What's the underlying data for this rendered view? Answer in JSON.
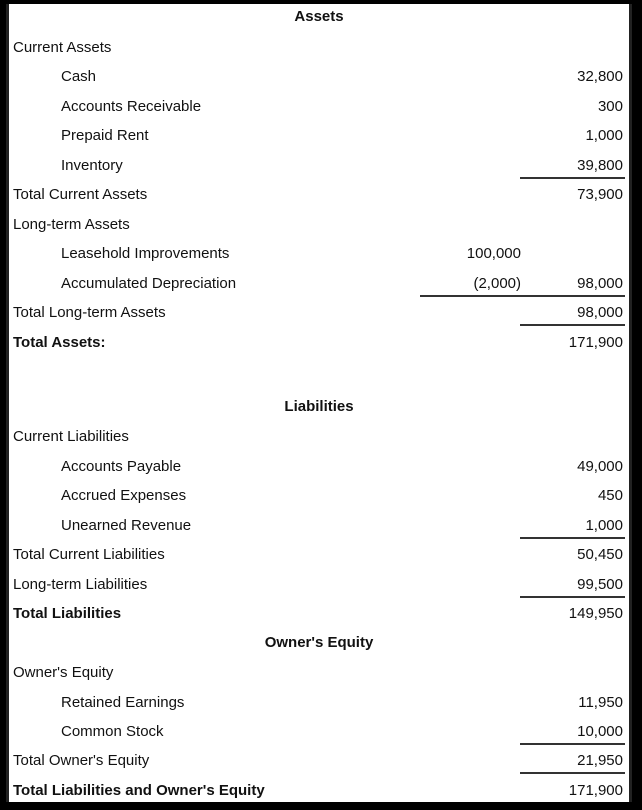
{
  "sections": {
    "assets_heading": "Assets",
    "liabilities_heading": "Liabilities",
    "equity_heading": "Owner's Equity"
  },
  "assets": {
    "current_assets_label": "Current Assets",
    "cash": {
      "label": "Cash",
      "value": "32,800"
    },
    "accounts_receivable": {
      "label": "Accounts Receivable",
      "value": "300"
    },
    "prepaid_rent": {
      "label": "Prepaid Rent",
      "value": "1,000"
    },
    "inventory": {
      "label": "Inventory",
      "value": "39,800"
    },
    "total_current": {
      "label": "Total Current Assets",
      "value": "73,900"
    },
    "long_term_label": "Long-term Assets",
    "leasehold": {
      "label": "Leasehold Improvements",
      "value": "100,000"
    },
    "accum_dep": {
      "label": "Accumulated Depreciation",
      "value": "(2,000)",
      "net": "98,000"
    },
    "total_long_term": {
      "label": "Total Long-term Assets",
      "value": "98,000"
    },
    "total_assets": {
      "label": "Total Assets:",
      "value": "171,900"
    }
  },
  "liabilities": {
    "current_label": "Current Liabilities",
    "accounts_payable": {
      "label": "Accounts Payable",
      "value": "49,000"
    },
    "accrued_expenses": {
      "label": "Accrued Expenses",
      "value": "450"
    },
    "unearned_revenue": {
      "label": "Unearned Revenue",
      "value": "1,000"
    },
    "total_current": {
      "label": "Total Current Liabilities",
      "value": "50,450"
    },
    "long_term": {
      "label": "Long-term Liabilities",
      "value": "99,500"
    },
    "total": {
      "label": "Total Liabilities",
      "value": "149,950"
    }
  },
  "equity": {
    "label": "Owner's Equity",
    "retained_earnings": {
      "label": "Retained Earnings",
      "value": "11,950"
    },
    "common_stock": {
      "label": "Common Stock",
      "value": "10,000"
    },
    "total": {
      "label": "Total Owner's Equity",
      "value": "21,950"
    },
    "total_liab_equity": {
      "label": "Total Liabilities and Owner's Equity",
      "value": "171,900"
    }
  }
}
